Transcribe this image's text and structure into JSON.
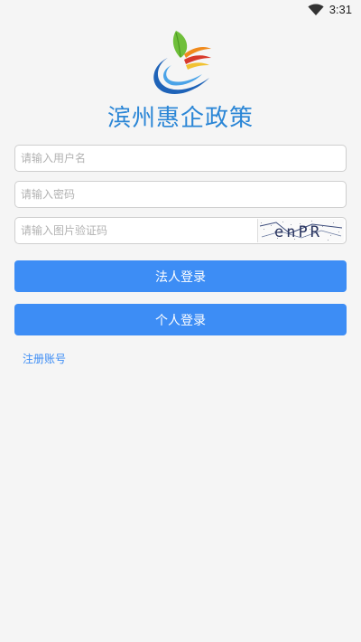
{
  "status_bar": {
    "time": "3:31",
    "wifi_icon": "wifi-icon"
  },
  "app": {
    "title": "滨州惠企政策",
    "logo_icon": "app-logo-icon",
    "brand_color": "#2b86d6"
  },
  "form": {
    "username_placeholder": "请输入用户名",
    "password_placeholder": "请输入密码",
    "captcha_placeholder": "请输入图片验证码",
    "captcha_text": "enPR"
  },
  "buttons": {
    "legal_login": "法人登录",
    "personal_login": "个人登录",
    "button_color": "#3d8df5"
  },
  "links": {
    "register": "注册账号"
  }
}
